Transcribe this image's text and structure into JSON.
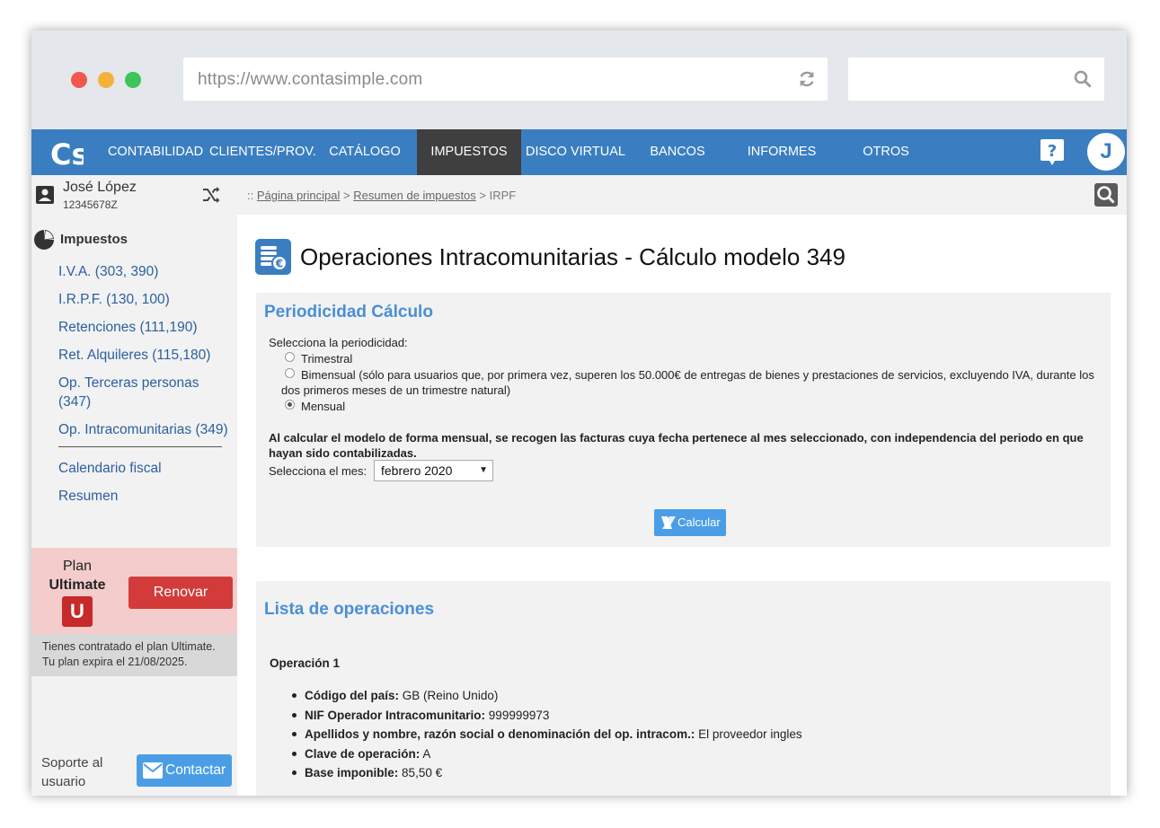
{
  "browser": {
    "url": "https://www.contasimple.com"
  },
  "navbar": {
    "logo_text": "Cs",
    "items": [
      {
        "label": "CONTABILIDAD"
      },
      {
        "label": "CLIENTES/PROV."
      },
      {
        "label": "CATÁLOGO"
      },
      {
        "label": "IMPUESTOS",
        "active": true
      },
      {
        "label": "DISCO VIRTUAL"
      },
      {
        "label": "BANCOS"
      },
      {
        "label": "INFORMES"
      },
      {
        "label": "OTROS"
      }
    ],
    "avatar_initial": "J",
    "accent_color": "#3a7ec1",
    "active_color": "#3f3f3f"
  },
  "user": {
    "name": "José López",
    "id": "12345678Z"
  },
  "breadcrumb": {
    "prefix": "::",
    "home": "Página principal",
    "sep1": ">",
    "section": "Resumen de impuestos",
    "sep2": ">",
    "current": "IRPF"
  },
  "sidebar": {
    "section_title": "Impuestos",
    "links": [
      {
        "label": "I.V.A. (303, 390)"
      },
      {
        "label": "I.R.P.F. (130, 100)"
      },
      {
        "label": "Retenciones (111,190)"
      },
      {
        "label": "Ret. Alquileres (115,180)"
      },
      {
        "label": "Op. Terceras personas (347)"
      },
      {
        "label": "Op. Intracomunitarias (349)"
      }
    ],
    "extra_links": [
      {
        "label": "Calendario fiscal"
      },
      {
        "label": "Resumen"
      }
    ]
  },
  "plan": {
    "label": "Plan",
    "name": "Ultimate",
    "badge": "U",
    "renew_label": "Renovar",
    "info_line1": "Tienes contratado el plan Ultimate.",
    "info_line2": "Tu plan expira el 21/08/2025."
  },
  "support": {
    "text": "Soporte al usuario",
    "contact_label": "Contactar"
  },
  "main": {
    "title": "Operaciones Intracomunitarias - Cálculo modelo 349",
    "periodicity": {
      "title": "Periodicidad Cálculo",
      "prompt": "Selecciona la periodicidad:",
      "options": [
        {
          "label": "Trimestral",
          "checked": false
        },
        {
          "label": "Bimensual (sólo para usuarios que, por primera vez, superen los 50.000€ de entregas de bienes y prestaciones de servicios, excluyendo IVA, durante los dos primeros meses de un trimestre natural)",
          "checked": false
        },
        {
          "label": "Mensual",
          "checked": true
        }
      ],
      "note": "Al calcular el modelo de forma mensual, se recogen las facturas cuya fecha pertenece al mes seleccionado, con independencia del periodo en que hayan sido contabilizadas.",
      "month_label": "Selecciona el mes:",
      "month_value": "febrero 2020",
      "calc_label": "Calcular"
    },
    "operations": {
      "title": "Lista de operaciones",
      "op_title": "Operación 1",
      "fields": [
        {
          "label": "Código del país:",
          "value": "GB (Reino Unido)"
        },
        {
          "label": "NIF Operador Intracomunitario:",
          "value": "999999973"
        },
        {
          "label": "Apellidos y nombre, razón social o denominación del op. intracom.:",
          "value": "El proveedor ingles"
        },
        {
          "label": "Clave de operación:",
          "value": "A"
        },
        {
          "label": "Base imponible:",
          "value": "85,50 €"
        }
      ]
    }
  }
}
